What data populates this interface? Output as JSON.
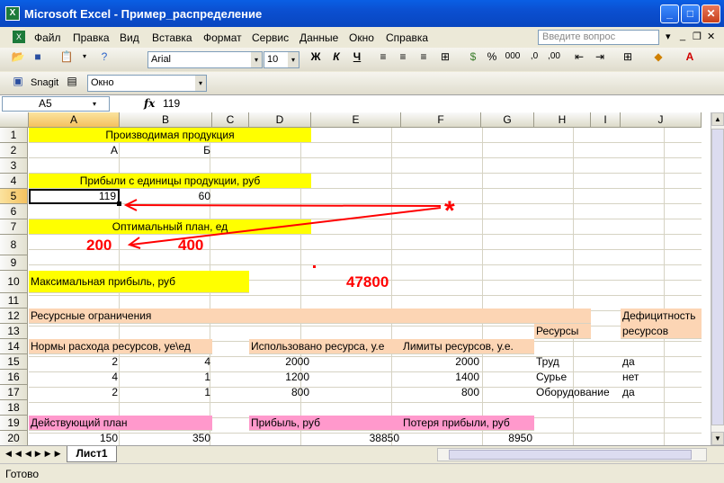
{
  "window": {
    "title": "Microsoft Excel - Пример_распределение"
  },
  "menu": {
    "items": [
      "Файл",
      "Правка",
      "Вид",
      "Вставка",
      "Формат",
      "Сервис",
      "Данные",
      "Окно",
      "Справка"
    ],
    "ask_placeholder": "Введите вопрос"
  },
  "toolbar": {
    "font": "Arial",
    "size": "10",
    "bold": "Ж",
    "italic": "К",
    "underline": "Ч",
    "percent": "%",
    "thousands": "000"
  },
  "toolbar2": {
    "snagit": "Snagit",
    "window": "Окно"
  },
  "formula": {
    "name_box": "A5",
    "fx": "fx",
    "value": "119"
  },
  "columns": [
    "A",
    "B",
    "C",
    "D",
    "E",
    "F",
    "G",
    "H",
    "I",
    "J"
  ],
  "rows": [
    "1",
    "2",
    "3",
    "4",
    "5",
    "6",
    "7",
    "8",
    "9",
    "10",
    "11",
    "12",
    "13",
    "14",
    "15",
    "16",
    "17",
    "18",
    "19",
    "20"
  ],
  "cells": {
    "r1": "Производимая продукция",
    "r2a": "А",
    "r2b": "Б",
    "r4": "Прибыли с единицы продукции, руб",
    "r5a": "119",
    "r5b": "60",
    "r7": "Оптимальный план, ед",
    "r10a": "Максимальная прибыль, руб",
    "r12a": "Ресурсные ограничения",
    "r12j": "Дефицитность",
    "r13h": "Ресурсы",
    "r13j": "ресурсов",
    "r14a": "Нормы расхода ресурсов, уе\\ед",
    "r14d": "Использовано ресурса, у.е",
    "r14f": "Лимиты ресурсов, у.е.",
    "r15a": "2",
    "r15b": "4",
    "r15d": "2000",
    "r15f": "2000",
    "r15h": "Труд",
    "r15j": "да",
    "r16a": "4",
    "r16b": "1",
    "r16d": "1200",
    "r16f": "1400",
    "r16h": "Сурье",
    "r16j": "нет",
    "r17a": "2",
    "r17b": "1",
    "r17d": "800",
    "r17f": "800",
    "r17h": "Оборудование",
    "r17j": "да",
    "r19a": "Действующий план",
    "r19d": "Прибыль, руб",
    "r19f": "Потеря прибыли, руб",
    "r20a": "150",
    "r20b": "350",
    "r20e": "38850",
    "r20g": "8950"
  },
  "annotations": {
    "v200": "200",
    "v400": "400",
    "v47800": "47800",
    "star": "*"
  },
  "sheet_tab": "Лист1",
  "status": "Готово",
  "colors": {
    "yellow": "#ffff00",
    "orange": "#fcd5b4",
    "pink": "#ff99cc",
    "red": "#ff0000"
  }
}
